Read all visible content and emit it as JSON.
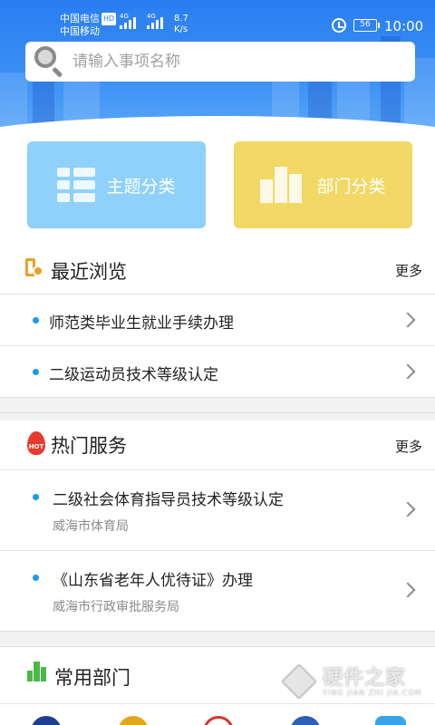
{
  "status_bar": {
    "carrier1": "中国电信",
    "hd": "HD",
    "carrier2": "中国移动",
    "net1": "4G",
    "net2": "4G",
    "speed_value": "8.7",
    "speed_unit": "K/s",
    "battery": "56",
    "time": "10:00",
    "icons": [
      "hd-icon",
      "signal-icon",
      "signal-icon",
      "alarm-icon",
      "battery-icon"
    ]
  },
  "search": {
    "placeholder": "请输入事项名称",
    "icon": "search-icon"
  },
  "categories": [
    {
      "label": "主题分类",
      "icon": "grid-list-icon",
      "color": "#8fd1fb"
    },
    {
      "label": "部门分类",
      "icon": "building-icon",
      "color": "#f2d865"
    }
  ],
  "recent": {
    "title": "最近浏览",
    "more": "更多",
    "icon": "recent-history-icon",
    "items": [
      {
        "title": "师范类毕业生就业手续办理"
      },
      {
        "title": "二级运动员技术等级认定"
      }
    ]
  },
  "hot": {
    "title": "热门服务",
    "more": "更多",
    "icon": "hot-flame-icon",
    "icon_text": "HOT",
    "items": [
      {
        "title": "二级社会体育指导员技术等级认定",
        "dept": "威海市体育局"
      },
      {
        "title": "《山东省老年人优待证》办理",
        "dept": "威海市行政审批服务局"
      }
    ]
  },
  "departments": {
    "title": "常用部门",
    "icon": "department-building-icon",
    "logos": [
      "department-logo",
      "department-logo",
      "department-logo",
      "department-logo",
      "department-logo"
    ]
  },
  "watermark": {
    "text": "硬件之家",
    "sub": "YING JIAN ZHI JIA.COM"
  },
  "colors": {
    "header_blue": "#2a7df0",
    "accent_dot": "#1e9ae6",
    "theme_tile": "#8fd1fb",
    "dept_tile": "#f2d865",
    "hot_red": "#e43b2e",
    "recent_orange": "#e9a227",
    "dept_green": "#4cb848"
  }
}
